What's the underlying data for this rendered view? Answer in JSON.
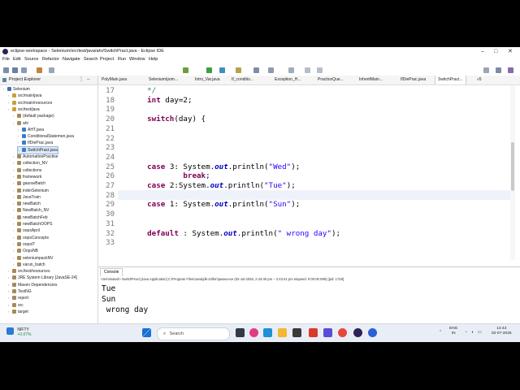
{
  "window": {
    "title": "eclipse-workspace - Selenium/src/test/java/ahr/SwitchPract.java - Eclipse IDE"
  },
  "menu": [
    "File",
    "Edit",
    "Source",
    "Refactor",
    "Navigate",
    "Search",
    "Project",
    "Run",
    "Window",
    "Help"
  ],
  "explorer": {
    "title": "Project Explorer",
    "items": [
      "Selenium",
      "src/main/java",
      "src/main/resources",
      "src/test/java",
      "(default package)",
      "ahr",
      "AHT.java",
      "ConditionalStatemen.java",
      "IfDiePrac.java",
      "SwitchPract.java",
      "AutomationPractise",
      "collection_NV",
      "collections",
      "framework",
      "gauravBatch",
      "inderSelenium",
      "JavaTrain",
      "newBatch",
      "NewBatch_NV",
      "newBatchFeb",
      "newBatchOOPS",
      "oopsApril",
      "oopsConcepts",
      "oopsIT",
      "OopsNB",
      "seleniumpackNV",
      "varun_batch",
      "src/test/resources",
      "JRE System Library [JavaSE-24]",
      "Maven Dependencies",
      "TestNG",
      "report",
      "src",
      "target"
    ]
  },
  "tabs": [
    "PolyMain.java",
    "Selenium/pom...",
    "Intro_Var.java",
    "If_conditio...",
    "Exception_H...",
    "PracticeQue...",
    "InheritMain...",
    "IfDiePrac.java",
    "SwitchPract...",
    "»5"
  ],
  "editor": {
    "lines": [
      {
        "n": "17",
        "code": [
          [
            "cmt",
            "    */"
          ]
        ]
      },
      {
        "n": "18",
        "code": [
          [
            "plain",
            "    "
          ],
          [
            "kw",
            "int"
          ],
          [
            "plain",
            " day=2;"
          ]
        ]
      },
      {
        "n": "19",
        "code": [
          [
            "plain",
            "    "
          ],
          [
            "kw",
            "switch"
          ],
          [
            "plain",
            "(day) {"
          ]
        ]
      },
      {
        "n": "20",
        "code": []
      },
      {
        "n": "21",
        "code": []
      },
      {
        "n": "22",
        "code": [
          [
            "plain",
            "    "
          ],
          [
            "kw",
            "case"
          ],
          [
            "plain",
            " 3: System."
          ],
          [
            "italic-blue",
            "out"
          ],
          [
            "plain",
            ".println("
          ],
          [
            "str",
            "\"Wed\""
          ],
          [
            "plain",
            ");"
          ]
        ]
      },
      {
        "n": "23",
        "code": [
          [
            "plain",
            "            "
          ],
          [
            "kw",
            "break"
          ],
          [
            "plain",
            ";"
          ]
        ]
      },
      {
        "n": "24",
        "code": [
          [
            "plain",
            "    "
          ],
          [
            "kw",
            "case"
          ],
          [
            "plain",
            " 2:System."
          ],
          [
            "italic-blue",
            "out"
          ],
          [
            "plain",
            ".println("
          ],
          [
            "str",
            "\"Tue\""
          ],
          [
            "plain",
            ");"
          ]
        ]
      },
      {
        "n": "25",
        "code": []
      },
      {
        "n": "26",
        "code": [
          [
            "plain",
            "    "
          ],
          [
            "kw",
            "case"
          ],
          [
            "plain",
            " 1: System."
          ],
          [
            "italic-blue",
            "out"
          ],
          [
            "plain",
            ".println("
          ],
          [
            "str",
            "\"Sun\""
          ],
          [
            "plain",
            ");"
          ]
        ]
      },
      {
        "n": "27",
        "code": []
      },
      {
        "n": "28",
        "code": [
          [
            "plain",
            "    "
          ],
          [
            "kw",
            "default"
          ],
          [
            "plain",
            " : System."
          ],
          [
            "italic-blue",
            "out"
          ],
          [
            "plain",
            ".println("
          ],
          [
            "str",
            "\" wrong day\""
          ],
          [
            "plain",
            ");"
          ]
        ]
      }
    ],
    "gutter_numbers": [
      "17",
      "18",
      "19",
      "20",
      "21",
      "22",
      "23",
      "24",
      "25",
      "26",
      "27",
      "28",
      "29",
      "30",
      "31",
      "32",
      "33"
    ]
  },
  "console": {
    "tab": "Console",
    "status": "<terminated> SwitchPract [Java Application] C:\\Program Files\\Java\\jdk-24\\bin\\javaw.exe (02-Jul-2026, 2:43:40 pm – 2:43:41 pm elapsed: 0:00:00.099) [pid: 1728]",
    "output": [
      "Tue",
      "Sun",
      " wrong day"
    ]
  },
  "taskbar": {
    "weather_title": "NIFTY",
    "weather_value": "+0.07%",
    "search_placeholder": "Search",
    "lang_top": "ENG",
    "lang_bottom": "IN",
    "time": "14:43",
    "date": "02-07-2026"
  },
  "colors": {
    "keyword": "#7f0055",
    "string": "#2a00ff",
    "field": "#0000c0",
    "comment": "#3f7f5f"
  }
}
